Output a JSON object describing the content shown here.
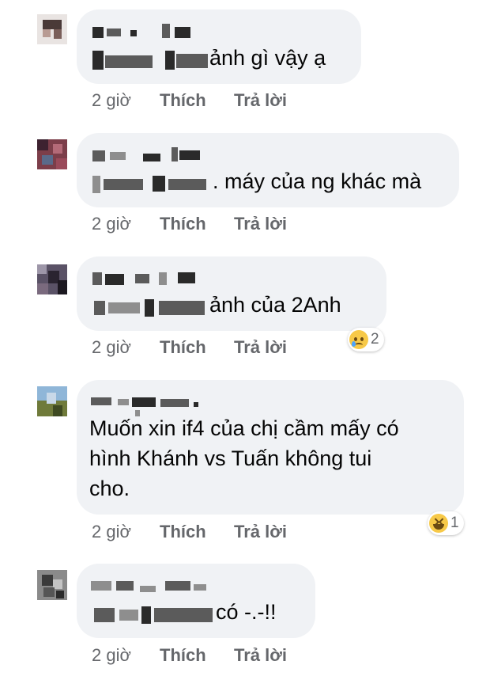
{
  "comments": [
    {
      "text": "ảnh gì vậy ạ",
      "time": "2 giờ",
      "like": "Thích",
      "reply": "Trả lời"
    },
    {
      "text": ". máy của ng khác mà",
      "time": "2 giờ",
      "like": "Thích",
      "reply": "Trả lời"
    },
    {
      "text": "ảnh của 2Anh",
      "time": "2 giờ",
      "like": "Thích",
      "reply": "Trả lời",
      "reaction": {
        "icon": "sad-icon",
        "count": "2"
      }
    },
    {
      "text_lines": [
        "Muốn xin if4 của chị cầm mấy có",
        "hình Khánh vs Tuấn không tui",
        "cho."
      ],
      "time": "2 giờ",
      "like": "Thích",
      "reply": "Trả lời",
      "reaction": {
        "icon": "laugh-icon",
        "count": "1"
      }
    },
    {
      "text": "có -.-!!",
      "time": "2 giờ",
      "like": "Thích",
      "reply": "Trả lời"
    }
  ],
  "colors": {
    "bubble": "#f0f2f5",
    "meta": "#65676b",
    "text": "#050505",
    "emoji": "#f7c948"
  }
}
